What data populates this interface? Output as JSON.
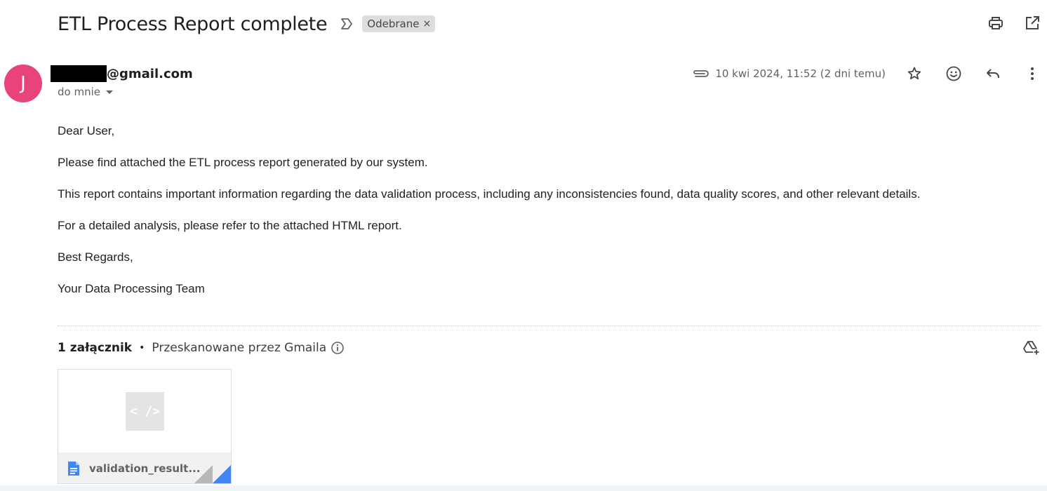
{
  "email": {
    "subject": "ETL Process Report complete",
    "label": "Odebrane",
    "label_remove": "×",
    "sender": {
      "avatar_letter": "J",
      "avatar_color": "#e8437b",
      "email_suffix": "@gmail.com",
      "to_text": "do mnie"
    },
    "date": "10 kwi 2024, 11:52 (2 dni temu)",
    "body": [
      "Dear User,",
      "Please find attached the ETL process report generated by our system.",
      "This report contains important information regarding the data validation process, including any inconsistencies found, data quality scores, and other relevant details.",
      "For a detailed analysis, please refer to the attached HTML report.",
      "Best Regards,",
      "Your Data Processing Team"
    ],
    "attachments": {
      "count_label": "1 załącznik",
      "separator": "•",
      "scanned_label": "Przeskanowane przez Gmaila",
      "items": [
        {
          "name": "validation_result...",
          "preview_glyph": "< />"
        }
      ]
    }
  },
  "icons": {
    "top": [
      "print-icon",
      "open-in-new-window-icon"
    ],
    "meta": [
      "attachment-icon",
      "star-icon",
      "emoji-reaction-icon",
      "reply-icon",
      "more-vert-icon"
    ],
    "attachment": [
      "info-icon",
      "add-to-drive-icon",
      "document-icon"
    ]
  },
  "colors": {
    "accent_blue": "#4285f4",
    "label_chip_bg": "#dddddd"
  }
}
